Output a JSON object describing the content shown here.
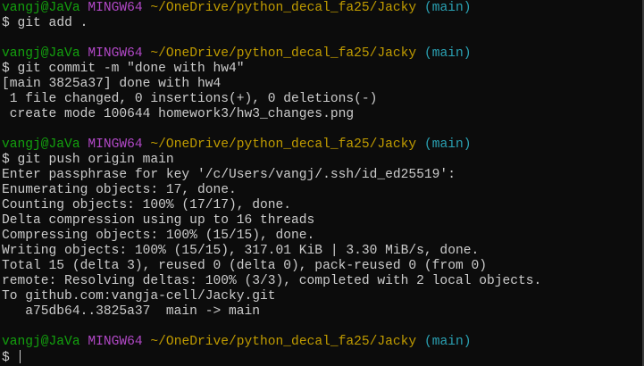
{
  "prompt": {
    "user": "vangj@JaVa",
    "system": "MINGW64",
    "path": "~/OneDrive/python_decal_fa25/Jacky",
    "branch": "(main)",
    "symbol": "$"
  },
  "colors": {
    "user": "#13a10e",
    "system": "#b148c6",
    "path": "#c19c00",
    "branch": "#2aa1b3",
    "text": "#cccccc",
    "background": "#0c0c0c"
  },
  "blocks": [
    {
      "command": "git add .",
      "output": []
    },
    {
      "command": "git commit -m \"done with hw4\"",
      "output": [
        "[main 3825a37] done with hw4",
        " 1 file changed, 0 insertions(+), 0 deletions(-)",
        " create mode 100644 homework3/hw3_changes.png"
      ]
    },
    {
      "command": "git push origin main",
      "output": [
        "Enter passphrase for key '/c/Users/vangj/.ssh/id_ed25519':",
        "Enumerating objects: 17, done.",
        "Counting objects: 100% (17/17), done.",
        "Delta compression using up to 16 threads",
        "Compressing objects: 100% (15/15), done.",
        "Writing objects: 100% (15/15), 317.01 KiB | 3.30 MiB/s, done.",
        "Total 15 (delta 3), reused 0 (delta 0), pack-reused 0 (from 0)",
        "remote: Resolving deltas: 100% (3/3), completed with 2 local objects.",
        "To github.com:vangja-cell/Jacky.git",
        "   a75db64..3825a37  main -> main"
      ]
    },
    {
      "command": "",
      "output": []
    }
  ]
}
